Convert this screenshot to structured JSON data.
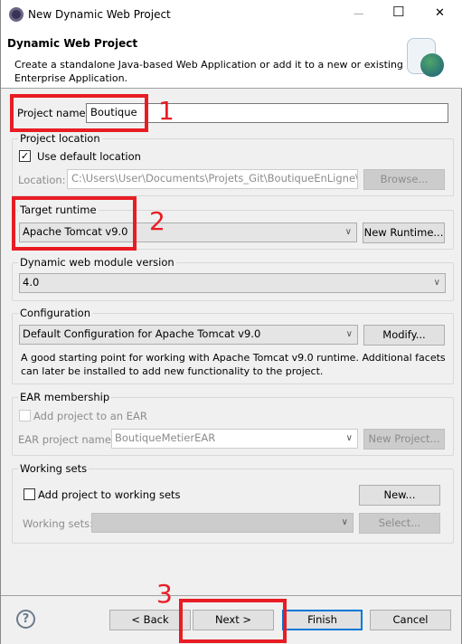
{
  "window": {
    "title": "New Dynamic Web Project",
    "minimize": "—",
    "maximize": "☐",
    "close": "✕"
  },
  "header": {
    "title": "Dynamic Web Project",
    "description_line1": "Create a standalone Java-based Web Application or add it to a new or existing",
    "description_line2": "Enterprise Application."
  },
  "project_name": {
    "label": "Project name:",
    "value": "Boutique"
  },
  "project_location": {
    "title": "Project location",
    "use_default_label": "Use default location",
    "use_default_checked": true,
    "location_label": "Location:",
    "location_value": "C:\\Users\\User\\Documents\\Projets_Git\\BoutiqueEnLigne\\Bo",
    "browse": "Browse..."
  },
  "target_runtime": {
    "title": "Target runtime",
    "value": "Apache Tomcat v9.0",
    "new_runtime": "New Runtime..."
  },
  "module_version": {
    "title": "Dynamic web module version",
    "value": "4.0"
  },
  "configuration": {
    "title": "Configuration",
    "value": "Default Configuration for Apache Tomcat v9.0",
    "modify": "Modify...",
    "desc_line1": "A good starting point for working with Apache Tomcat v9.0 runtime. Additional facets",
    "desc_line2": "can later be installed to add new functionality to the project."
  },
  "ear": {
    "title": "EAR membership",
    "add_label": "Add project to an EAR",
    "add_checked": false,
    "name_label": "EAR project name:",
    "name_value": "BoutiqueMetierEAR",
    "new_project": "New Project..."
  },
  "working_sets": {
    "title": "Working sets",
    "add_label": "Add project to working sets",
    "add_checked": false,
    "new": "New...",
    "sets_label": "Working sets:",
    "sets_value": "",
    "select": "Select..."
  },
  "footer": {
    "help": "?",
    "back": "< Back",
    "next": "Next >",
    "finish": "Finish",
    "cancel": "Cancel"
  },
  "annotations": {
    "step1": "1",
    "step2": "2",
    "step3": "3",
    "color": "#e81c24"
  }
}
